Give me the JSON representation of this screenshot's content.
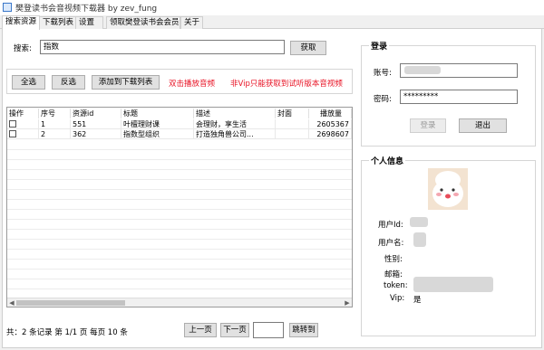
{
  "window": {
    "title": "樊登读书会音视频下载器 by zev_fung"
  },
  "tabs": [
    "搜索资源",
    "下载列表",
    "设置",
    "领取樊登读书会会员",
    "关于"
  ],
  "search": {
    "label": "搜索:",
    "value": "指数",
    "button": "获取"
  },
  "actions": {
    "select_all": "全选",
    "invert": "反选",
    "add_to_download": "添加到下载列表",
    "hint1": "双击播放音频",
    "hint2": "非Vip只能获取到试听版本音视频"
  },
  "grid": {
    "columns": [
      "操作",
      "序号",
      "资源id",
      "标题",
      "描述",
      "封面",
      "播放量"
    ],
    "rows": [
      {
        "index": "1",
        "id": "551",
        "title": "叶檀理财课",
        "desc": "会理财，享生活",
        "cover": "",
        "plays": "2605367"
      },
      {
        "index": "2",
        "id": "362",
        "title": "指数型组织",
        "desc": "打造独角兽公司...",
        "cover": "",
        "plays": "2698607"
      }
    ]
  },
  "pager": {
    "status": "共：2 条记录 第 1/1 页 每页 10 条",
    "prev": "上一页",
    "next": "下一页",
    "page_value": "",
    "jump": "跳转到"
  },
  "login": {
    "title": "登录",
    "account_label": "账号:",
    "account_value": "",
    "password_label": "密码:",
    "password_value": "*********",
    "login_button": "登录",
    "logout_button": "退出"
  },
  "profile": {
    "title": "个人信息",
    "user_id_label": "用户Id:",
    "username_label": "用户名:",
    "gender_label": "性别:",
    "email_label": "邮箱:",
    "token_label": "token:",
    "vip_label": "Vip:",
    "vip_value": "是"
  }
}
